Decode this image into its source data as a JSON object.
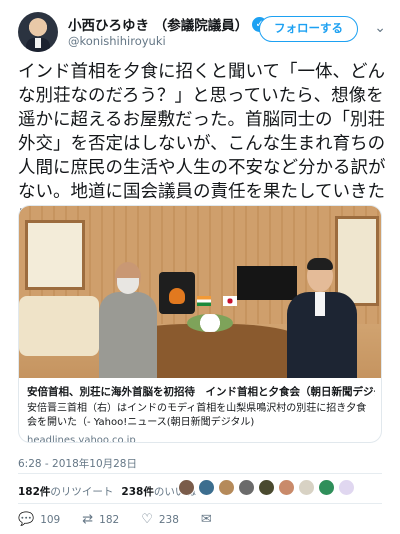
{
  "user": {
    "display_name": "小西ひろゆき （参議院議員）",
    "handle": "@konishihiroyuki",
    "verified_glyph": "✓"
  },
  "follow_label": "フォローする",
  "tweet_text": "インド首相を夕食に招くと聞いて「一体、どんな別荘なのだろう？」と思っていたら、想像を遥かに超えるお屋敷だった。首脳同士の「別荘外交」を否定はしないが、こんな生まれ育ちの人間に庶民の生活や人生の不安など分かる訳がない。地道に国会議員の責任を果たしていきたい。",
  "card": {
    "title": "安倍首相、別荘に海外首脳を初招待　インド首相と夕食会（朝日新聞デジタル） - ...",
    "description": "安倍晋三首相（右）はインドのモディ首相を山梨県鳴沢村の別荘に招き夕食会を開いた（- Yahoo!ニュース(朝日新聞デジタル)",
    "domain": "headlines.yahoo.co.jp"
  },
  "timestamp": "6:28 - 2018年10月28日",
  "stats": {
    "retweets_count": "182件",
    "retweets_label": "のリツイート",
    "likes_count": "238件",
    "likes_label": "のいいね"
  },
  "actions": {
    "reply_count": "109",
    "retweet_count": "182",
    "like_count": "238"
  },
  "icons": {
    "chevron": "chevron-down-icon",
    "reply": "reply-icon",
    "retweet": "retweet-icon",
    "like": "heart-icon",
    "dm": "mail-icon"
  },
  "colors": {
    "accent": "#1da1f2",
    "muted": "#657786"
  }
}
